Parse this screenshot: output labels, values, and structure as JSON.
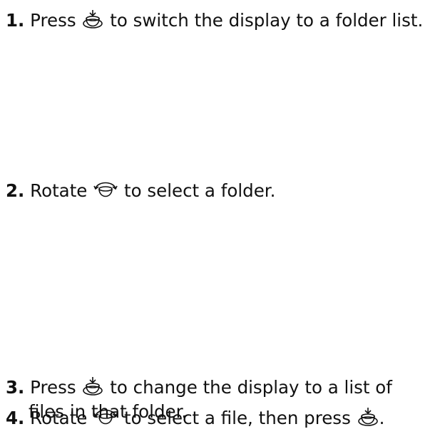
{
  "steps": [
    {
      "number": "1.",
      "before": "Press",
      "icon1": "push-knob-icon",
      "after": "to switch the display to a folder list."
    },
    {
      "number": "2.",
      "before": "Rotate",
      "icon1": "rotate-knob-icon",
      "after": "to select a folder."
    },
    {
      "number": "3.",
      "before": "Press",
      "icon1": "push-knob-icon",
      "after": "to change the display to a list of",
      "line2": "files in that folder."
    },
    {
      "number": "4.",
      "before": "Rotate",
      "icon1": "rotate-knob-icon",
      "after": "to select a file, then press",
      "icon2": "push-knob-icon",
      "end": "."
    }
  ]
}
